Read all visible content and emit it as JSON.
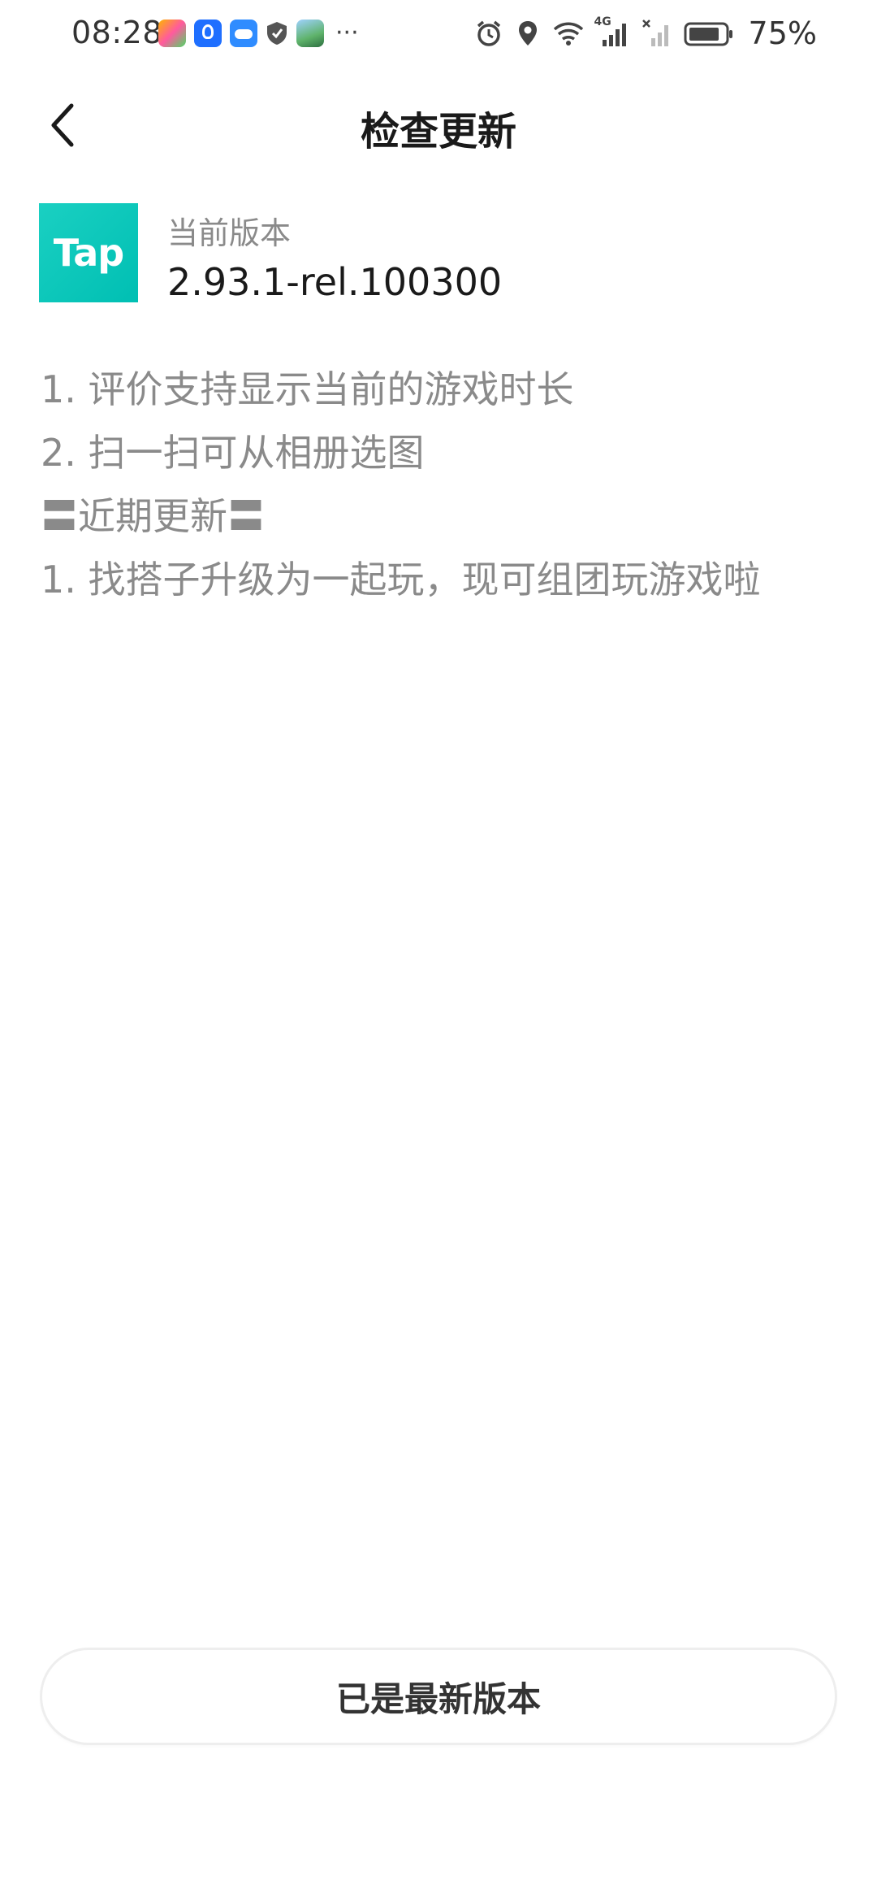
{
  "status_bar": {
    "time": "08:28",
    "battery_percent": "75%",
    "network_label": "4G",
    "overflow_indicator": "···"
  },
  "header": {
    "title": "检查更新"
  },
  "app": {
    "logo_text": "Tap",
    "version_label": "当前版本",
    "version_value": "2.93.1-rel.100300"
  },
  "changelog": {
    "lines": [
      "1. 评价支持显示当前的游戏时长",
      "2. 扫一扫可从相册选图",
      "〓近期更新〓",
      "1. 找搭子升级为一起玩，现可组团玩游戏啦"
    ]
  },
  "footer": {
    "button_label": "已是最新版本"
  },
  "colors": {
    "brand": "#00C4B8",
    "title": "#1A1A1A",
    "muted": "#8A8A8A"
  }
}
